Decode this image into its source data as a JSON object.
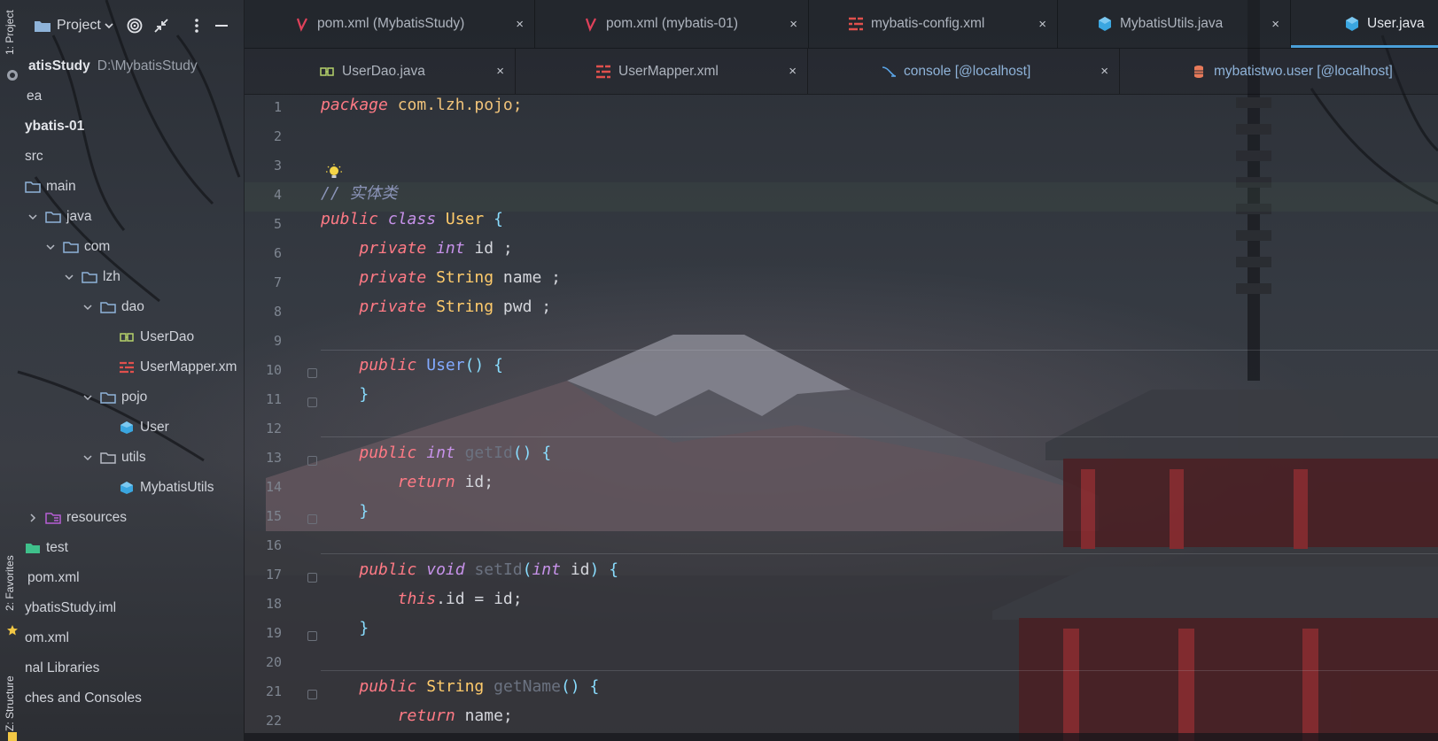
{
  "colors": {
    "accent": "#4a9fd8",
    "keyword": "#ff7a85",
    "type": "#ffcb6b",
    "method": "#82aaff",
    "brace": "#89ddff",
    "comment": "#8b94b8"
  },
  "strip": {
    "project_tab": "1: Project",
    "favorites_tab": "2: Favorites",
    "structure_tab": "Z: Structure"
  },
  "project_panel": {
    "title": "Project",
    "view_selector_icon": "chevron-down-icon",
    "locate_icon": "target-icon",
    "collapse_icon": "collapse-icon",
    "menu_icon": "kebab-icon",
    "minimize_icon": "minimize-icon",
    "tree": [
      {
        "label": "atisStudy",
        "path": "D:\\MybatisStudy",
        "bold": true,
        "icon": ""
      },
      {
        "label": "ea",
        "icon": ""
      },
      {
        "label": "ybatis-01",
        "bold": true,
        "icon": ""
      },
      {
        "label": "src",
        "icon": ""
      },
      {
        "label": "main",
        "icon": "folder-icon"
      },
      {
        "label": "java",
        "icon": "folder-icon",
        "expanded": true
      },
      {
        "label": "com",
        "icon": "folder-icon",
        "expanded": true
      },
      {
        "label": "lzh",
        "icon": "folder-icon",
        "expanded": true
      },
      {
        "label": "dao",
        "icon": "folder-icon",
        "expanded": true
      },
      {
        "label": "UserDao",
        "icon": "interface-icon"
      },
      {
        "label": "UserMapper.xm",
        "icon": "mapper-xml-icon"
      },
      {
        "label": "pojo",
        "icon": "folder-icon",
        "expanded": true
      },
      {
        "label": "User",
        "icon": "class-icon"
      },
      {
        "label": "utils",
        "icon": "folder-icon",
        "expanded": true
      },
      {
        "label": "MybatisUtils",
        "icon": "class-icon"
      },
      {
        "label": "resources",
        "icon": "resources-folder-icon",
        "expanded": false
      },
      {
        "label": "test",
        "icon": "test-folder-icon"
      },
      {
        "label": "pom.xml",
        "icon": ""
      },
      {
        "label": "ybatisStudy.iml",
        "icon": ""
      },
      {
        "label": "om.xml",
        "icon": ""
      },
      {
        "label": "nal Libraries",
        "icon": ""
      },
      {
        "label": "ches and Consoles",
        "icon": ""
      }
    ]
  },
  "tabs_row1": [
    {
      "label": "pom.xml (MybatisStudy)",
      "icon": "maven-icon"
    },
    {
      "label": "pom.xml (mybatis-01)",
      "icon": "maven-icon"
    },
    {
      "label": "mybatis-config.xml",
      "icon": "mybatis-xml-icon"
    },
    {
      "label": "MybatisUtils.java",
      "icon": "class-icon"
    },
    {
      "label": "User.java",
      "icon": "class-icon",
      "active": true
    }
  ],
  "tabs_row2": [
    {
      "label": "UserDao.java",
      "icon": "interface-icon"
    },
    {
      "label": "UserMapper.xml",
      "icon": "mapper-xml-icon"
    },
    {
      "label": "console [@localhost]",
      "icon": "console-icon"
    },
    {
      "label": "mybatistwo.user [@localhost]",
      "icon": "database-table-icon"
    }
  ],
  "close_glyph": "×",
  "editor": {
    "line_numbers": [
      "1",
      "2",
      "3",
      "4",
      "5",
      "6",
      "7",
      "8",
      "9",
      "10",
      "11",
      "12",
      "13",
      "14",
      "15",
      "16",
      "17",
      "18",
      "19",
      "20",
      "21",
      "22"
    ],
    "lines": {
      "l1": {
        "kw": "package",
        "rest": " com.lzh.pojo;"
      },
      "l4": {
        "comment": "// 实体类"
      },
      "l5": {
        "kw1": "public",
        "kw2": "class",
        "name": "User",
        "brace": "{"
      },
      "l6": {
        "kw": "private",
        "type": "int",
        "rest": " id ;"
      },
      "l7": {
        "kw": "private",
        "type": "String",
        "rest": " name ;"
      },
      "l8": {
        "kw": "private",
        "type": "String",
        "rest": " pwd ;"
      },
      "l10": {
        "kw": "public",
        "name": "User",
        "parens": "()",
        "brace": "{"
      },
      "l11": {
        "brace": "}"
      },
      "l13": {
        "kw": "public",
        "type": "int",
        "name": "getId",
        "parens": "()",
        "brace": "{"
      },
      "l14": {
        "kw": "return",
        "rest": " id;"
      },
      "l15": {
        "brace": "}"
      },
      "l17": {
        "kw": "public",
        "type": "void",
        "name": "setId",
        "open": "(",
        "ptype": "int",
        "pname": " id",
        "close": ")",
        "brace": "{"
      },
      "l18": {
        "kw": "this",
        "rest": ".id = id;"
      },
      "l19": {
        "brace": "}"
      },
      "l21": {
        "kw": "public",
        "type": "String",
        "name": "getName",
        "parens": "()",
        "brace": "{"
      },
      "l22": {
        "kw": "return",
        "rest": " name;"
      }
    },
    "intention_icon": "lightbulb-icon"
  }
}
